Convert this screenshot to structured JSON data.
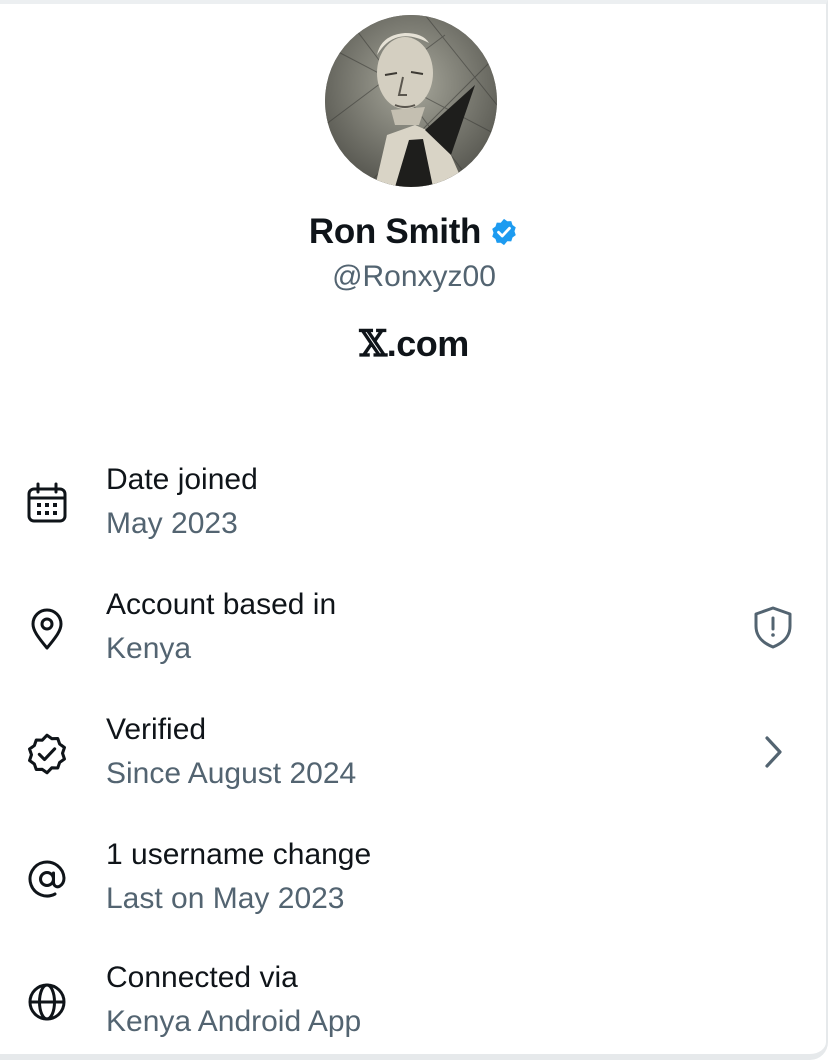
{
  "profile": {
    "name": "Ron Smith",
    "handle": "@Ronxyz00",
    "site_prefix": "𝕏",
    "site_suffix": ".com",
    "verified_badge_color": "#1d9bf0"
  },
  "rows": [
    {
      "icon": "calendar-icon",
      "title": "Date joined",
      "subtitle": "May 2023"
    },
    {
      "icon": "location-pin-icon",
      "title": "Account based in",
      "subtitle": "Kenya",
      "trailing": "shield-alert-icon"
    },
    {
      "icon": "verified-badge-outline-icon",
      "title": "Verified",
      "subtitle": "Since August 2024",
      "trailing": "chevron-right-icon"
    },
    {
      "icon": "at-sign-icon",
      "title": "1 username change",
      "subtitle": "Last on May 2023"
    },
    {
      "icon": "globe-icon",
      "title": "Connected via",
      "subtitle": "Kenya Android App"
    }
  ],
  "colors": {
    "primary_text": "#0f1419",
    "secondary_text": "#536471",
    "accent": "#1d9bf0"
  }
}
